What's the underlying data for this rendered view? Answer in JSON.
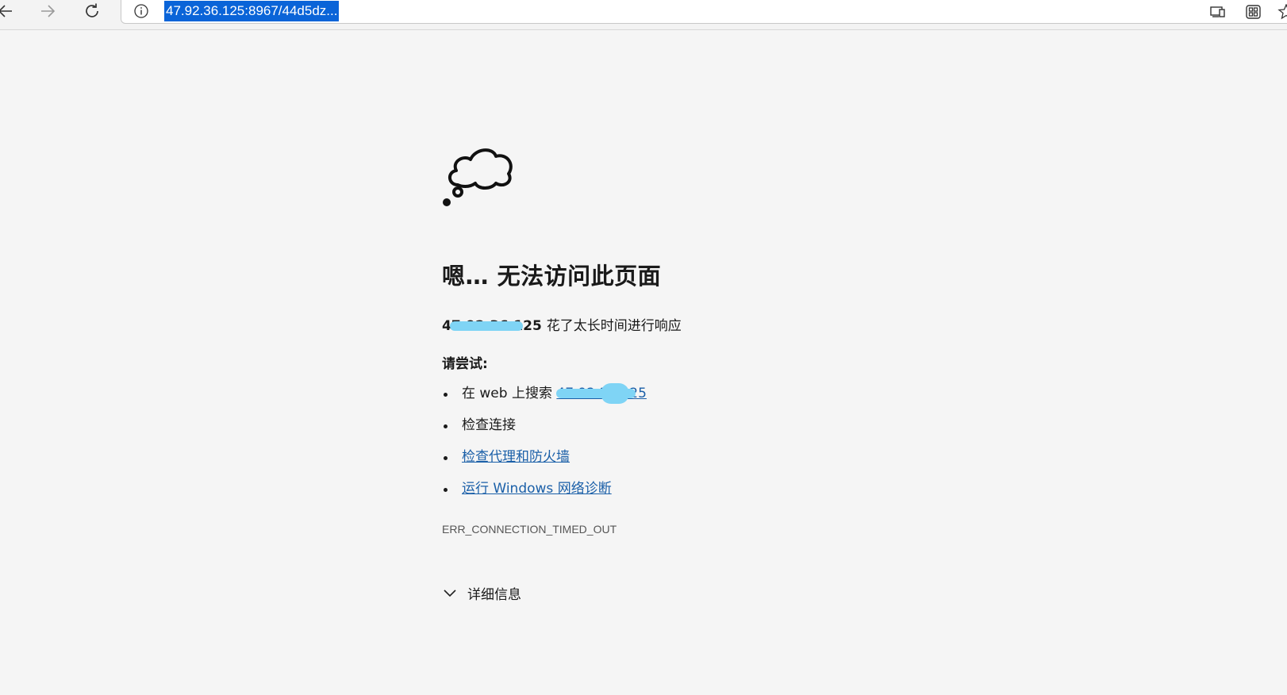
{
  "browser": {
    "url": "47.92.36.125:8967/44d5dz...",
    "icons": [
      "back-arrow-icon",
      "forward-arrow-icon",
      "refresh-icon",
      "info-icon",
      "device-icon",
      "extensions-icon",
      "favorite-star-icon"
    ]
  },
  "error_page": {
    "title": "嗯… 无法访问此页面",
    "host": "47.92.36.125",
    "host_message": " 花了太长时间进行响应",
    "try_label": "请尝试:",
    "suggestions": {
      "search_prefix": "在 web 上搜索 ",
      "search_term": "47.92.36.125",
      "check_connection": "检查连接",
      "check_proxy": "检查代理和防火墙",
      "run_diagnostics": "运行 Windows 网络诊断"
    },
    "error_code": "ERR_CONNECTION_TIMED_OUT",
    "details_label": "详细信息"
  },
  "colors": {
    "link": "#1a5fa8",
    "url_highlight": "#0a64d8",
    "redaction": "#7fd4f5",
    "background": "#f5f5f5"
  }
}
